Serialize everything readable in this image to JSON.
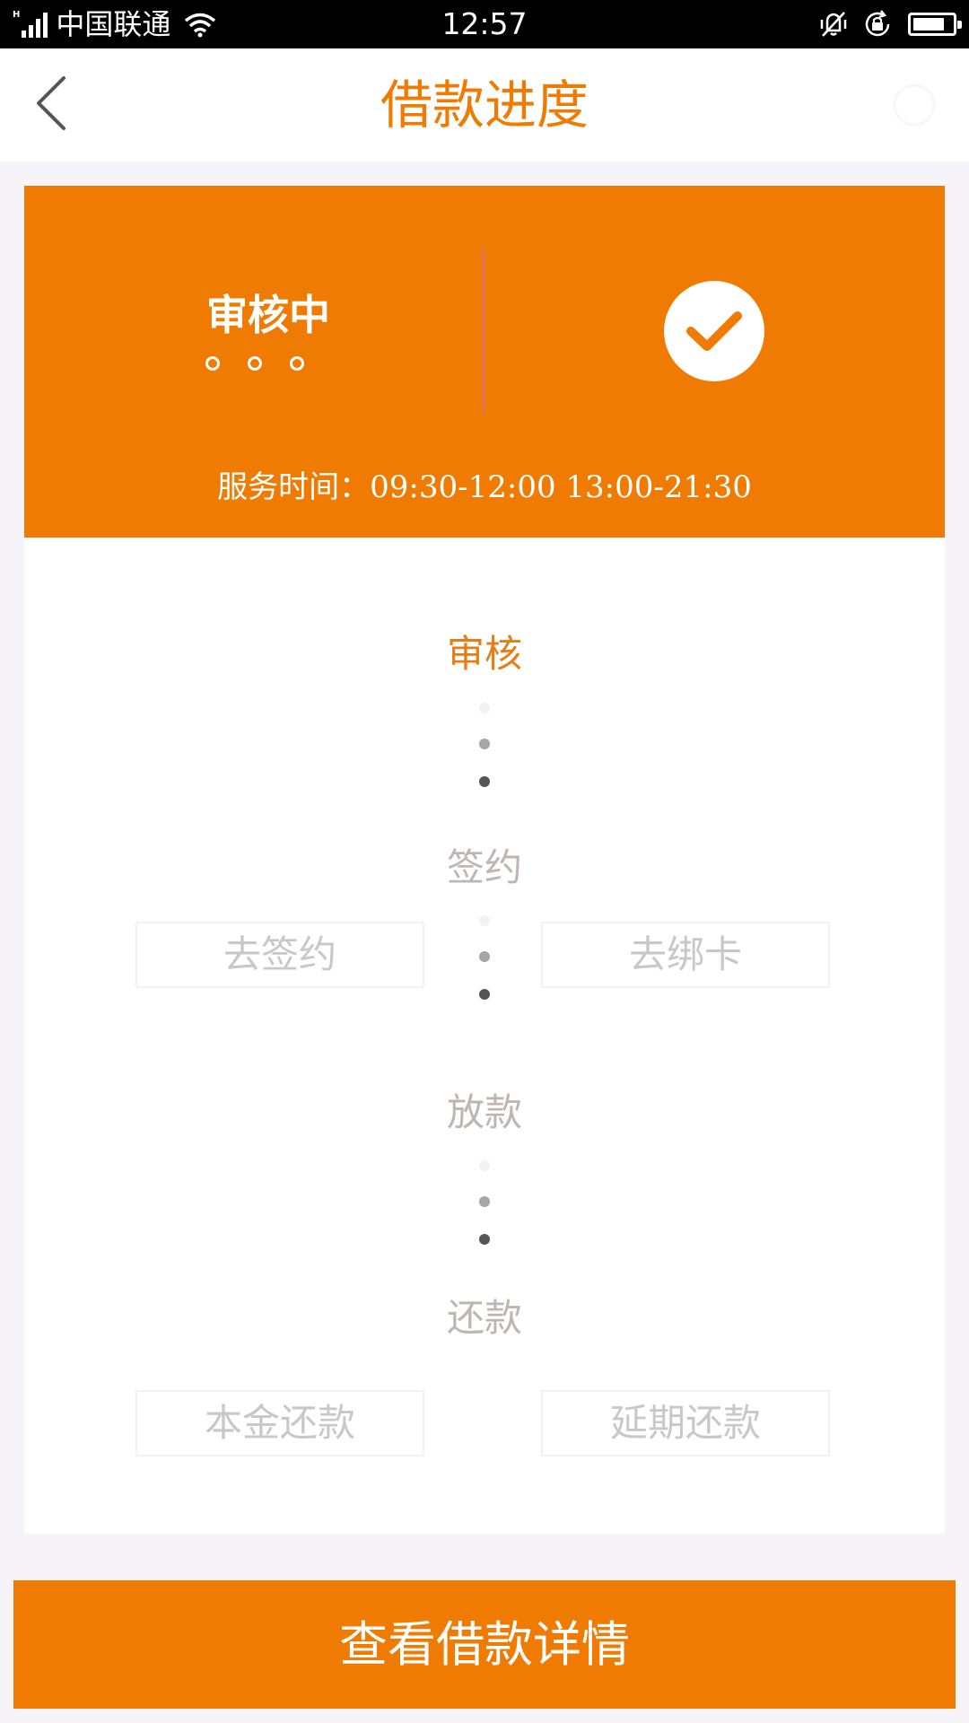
{
  "status_bar": {
    "network_type": "H",
    "carrier": "中国联通",
    "time": "12:57",
    "icons": [
      "signal-icon",
      "wifi-icon",
      "vibrate-icon",
      "rotation-lock-icon",
      "battery-icon"
    ],
    "battery_level": 0.8
  },
  "nav": {
    "title": "借款进度",
    "back_icon": "chevron-left-icon",
    "title_color": "#ef7b02"
  },
  "status_card": {
    "status": "审核中",
    "service_time_label": "服务时间：",
    "service_time_value": "09:30-12:00 13:00-21:30",
    "icon": "check-circle-icon",
    "background_color": "#ef7b02"
  },
  "steps": [
    {
      "label": "审核",
      "state": "active"
    },
    {
      "label": "签约",
      "state": "inactive"
    },
    {
      "label": "放款",
      "state": "inactive"
    },
    {
      "label": "还款",
      "state": "inactive"
    }
  ],
  "actions": {
    "sign": "去签约",
    "bind_card": "去绑卡",
    "repay_principal": "本金还款",
    "extend_repayment": "延期还款"
  },
  "bottom_button": {
    "label": "查看借款详情"
  },
  "colors": {
    "accent": "#ef7b02",
    "step_active": "#e67e16",
    "step_inactive": "#bfb6b0",
    "page_background": "#f6f4f9"
  }
}
